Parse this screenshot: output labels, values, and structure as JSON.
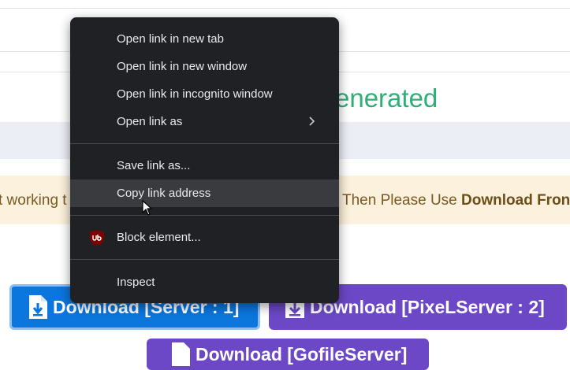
{
  "page": {
    "heading_fragment": "enerated",
    "warning_left": "t working t",
    "warning_right_prefix": "Then Please Use ",
    "warning_right_bold": "Download Fron",
    "colors": {
      "heading": "#2fae75",
      "warning_bg": "#fbf1dc",
      "blue": "#0b76dd",
      "purple": "#6c48c6"
    }
  },
  "buttons": [
    {
      "label": "Download [Server : 1]",
      "icon": "file-download-icon"
    },
    {
      "label": "Download [PixeLServer : 2]",
      "icon": "download-arrow-icon"
    },
    {
      "label": "Download [GofileServer]",
      "icon": "file-download-icon"
    }
  ],
  "context_menu": {
    "items": [
      {
        "label": "Open link in new tab"
      },
      {
        "label": "Open link in new window"
      },
      {
        "label": "Open link in incognito window"
      },
      {
        "label": "Open link as",
        "icon": "chevron-right-icon"
      },
      {
        "label": "Save link as..."
      },
      {
        "label": "Copy link address",
        "state": "hovered"
      },
      {
        "label": "Block element...",
        "icon": "ublock-origin-icon"
      },
      {
        "label": "Inspect"
      }
    ]
  }
}
